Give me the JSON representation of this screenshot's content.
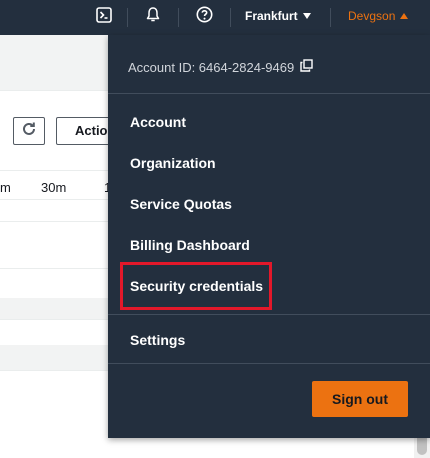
{
  "topbar": {
    "region_label": "Frankfurt",
    "user_label": "Devgson"
  },
  "background": {
    "actions_label": "Actio",
    "time_ranges": [
      "m",
      "30m",
      "1"
    ]
  },
  "menu": {
    "account_id": "Account ID: 6464-2824-9469",
    "items": [
      {
        "label": "Account"
      },
      {
        "label": "Organization"
      },
      {
        "label": "Service Quotas"
      },
      {
        "label": "Billing Dashboard"
      },
      {
        "label": "Security credentials"
      },
      {
        "label": "Settings"
      }
    ],
    "signout_label": "Sign out"
  },
  "colors": {
    "nav_bg": "#232f3e",
    "accent": "#ec7211",
    "highlight": "#e3182a"
  }
}
